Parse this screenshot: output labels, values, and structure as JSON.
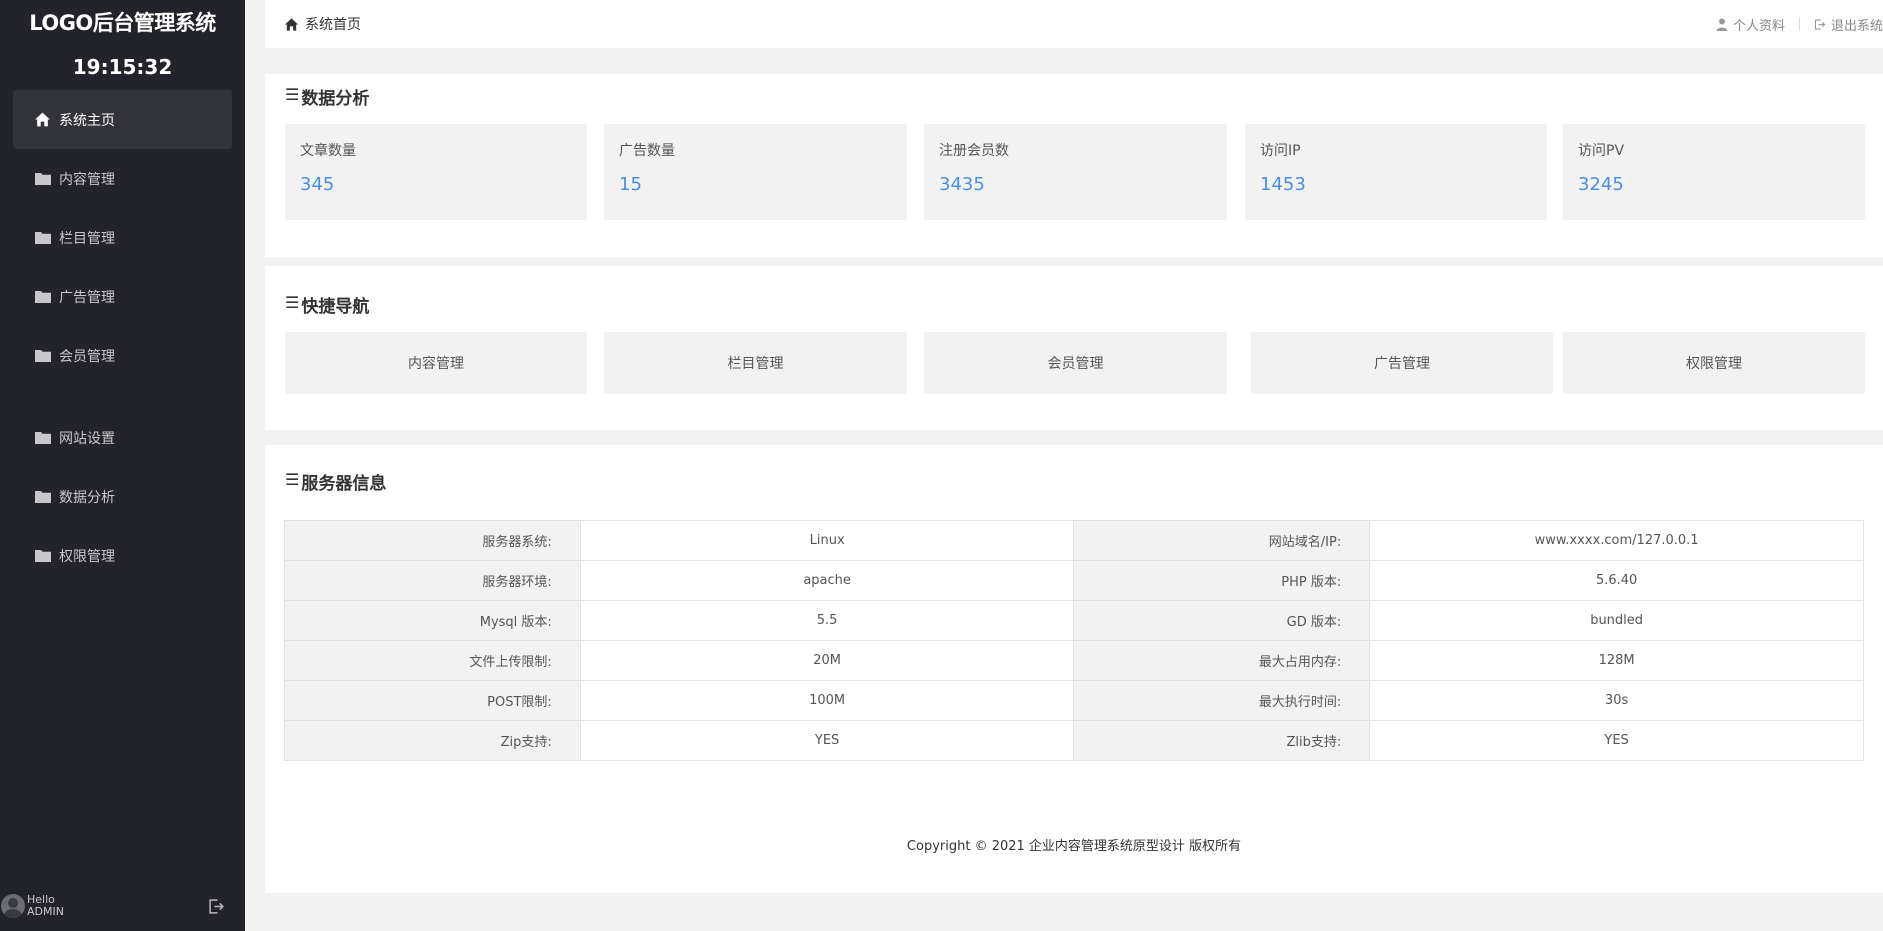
{
  "sidebar": {
    "logo": "LOGO后台管理系统",
    "clock": "19:15:32",
    "items": [
      {
        "label": "系统主页",
        "icon": "home-icon"
      },
      {
        "label": "内容管理",
        "icon": "folder-icon"
      },
      {
        "label": "栏目管理",
        "icon": "folder-icon"
      },
      {
        "label": "广告管理",
        "icon": "folder-icon"
      },
      {
        "label": "会员管理",
        "icon": "folder-icon"
      },
      {
        "label": "网站设置",
        "icon": "folder-icon"
      },
      {
        "label": "数据分析",
        "icon": "folder-icon"
      },
      {
        "label": "权限管理",
        "icon": "folder-icon"
      }
    ],
    "user": {
      "greeting": "Hello",
      "name": "ADMIN"
    }
  },
  "topbar": {
    "breadcrumb": "系统首页",
    "profile": "个人资料",
    "logout": "退出系统"
  },
  "stats": {
    "title": "数据分析",
    "items": [
      {
        "label": "文章数量",
        "value": "345"
      },
      {
        "label": "广告数量",
        "value": "15"
      },
      {
        "label": "注册会员数",
        "value": "3435"
      },
      {
        "label": "访问IP",
        "value": "1453"
      },
      {
        "label": "访问PV",
        "value": "3245"
      }
    ]
  },
  "quicknav": {
    "title": "快捷导航",
    "items": [
      "内容管理",
      "栏目管理",
      "会员管理",
      "广告管理",
      "权限管理"
    ]
  },
  "server": {
    "title": "服务器信息",
    "rows": [
      [
        {
          "k": "服务器系统:",
          "v": "Linux"
        },
        {
          "k": "网站域名/IP:",
          "v": "www.xxxx.com/127.0.0.1"
        }
      ],
      [
        {
          "k": "服务器环境:",
          "v": "apache"
        },
        {
          "k": "PHP 版本:",
          "v": "5.6.40"
        }
      ],
      [
        {
          "k": "Mysql 版本:",
          "v": "5.5"
        },
        {
          "k": "GD 版本:",
          "v": "bundled"
        }
      ],
      [
        {
          "k": "文件上传限制:",
          "v": "20M"
        },
        {
          "k": "最大占用内存:",
          "v": "128M"
        }
      ],
      [
        {
          "k": "POST限制:",
          "v": "100M"
        },
        {
          "k": "最大执行时间:",
          "v": "30s"
        }
      ],
      [
        {
          "k": "Zip支持:",
          "v": "YES"
        },
        {
          "k": "Zlib支持:",
          "v": "YES"
        }
      ]
    ]
  },
  "footer": {
    "copyright": "Copyright © 2021 企业内容管理系统原型设计 版权所有"
  },
  "colors": {
    "sidebar_bg": "#23232b",
    "accent": "#4a8fe0",
    "page_bg": "#f2f2f2"
  }
}
